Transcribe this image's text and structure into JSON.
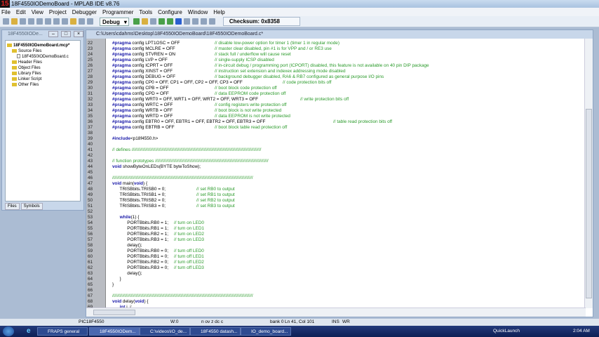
{
  "window": {
    "title": "18F4550IODemoBoard - MPLAB IDE v8.76",
    "logo": "15"
  },
  "menu": [
    "File",
    "Edit",
    "View",
    "Project",
    "Debugger",
    "Programmer",
    "Tools",
    "Configure",
    "Window",
    "Help"
  ],
  "toolbar": {
    "config": "Debug",
    "checksum": "Checksum: 0x8358"
  },
  "project": {
    "title": "18F4550IODe...",
    "tree": [
      {
        "label": "18F4550IODemoBoard.mcp*",
        "type": "project",
        "depth": 0
      },
      {
        "label": "Source Files",
        "type": "folder",
        "depth": 1
      },
      {
        "label": "18F4550IODemoBoard.c",
        "type": "file",
        "depth": 2
      },
      {
        "label": "Header Files",
        "type": "folder",
        "depth": 1
      },
      {
        "label": "Object Files",
        "type": "folder",
        "depth": 1
      },
      {
        "label": "Library Files",
        "type": "folder",
        "depth": 1
      },
      {
        "label": "Linker Script",
        "type": "folder",
        "depth": 1
      },
      {
        "label": "Other Files",
        "type": "folder",
        "depth": 1
      }
    ],
    "tabs": [
      "Files",
      "Symbols"
    ]
  },
  "editor": {
    "path": "C:\\Users\\cdahms\\Desktop\\18F4550IODemoBoard\\18F4550IODemoBoard.c*",
    "lines": [
      {
        "n": "22",
        "kw": "#pragma",
        "code": " config LPT1OSC = OFF",
        "cm": "// disable low-power option for timer 1 (timer 1 in regular mode)"
      },
      {
        "n": "23",
        "kw": "#pragma",
        "code": " config MCLRE = OFF",
        "cm": "// master clear disabled, pin #1 is for VPP and / or RE3 use"
      },
      {
        "n": "24",
        "kw": "#pragma",
        "code": " config STVREN = ON",
        "cm": "// stack full / underflow will cause reset"
      },
      {
        "n": "25",
        "kw": "#pragma",
        "code": " config LVP = OFF",
        "cm": "// single-supply ICSP disabled"
      },
      {
        "n": "26",
        "kw": "#pragma",
        "code": " config ICPRT = OFF",
        "cm": "// in-circuit debug / programming port (ICPORT) disabled, this feature is not available on 40 pin DIP package"
      },
      {
        "n": "27",
        "kw": "#pragma",
        "code": " config XINST = OFF",
        "cm": "// instruction set extension and indexex addressing mode disabled"
      },
      {
        "n": "28",
        "kw": "#pragma",
        "code": " config DEBUG = OFF",
        "cm": "// background debugger disabled, RA6 & RB7 configured as general purpose I/O pins"
      },
      {
        "n": "29",
        "kw": "#pragma",
        "code": " config CP0 = OFF, CP1 = OFF, CP2 = OFF, CP3 = OFF",
        "cm": "// code protection bits off"
      },
      {
        "n": "30",
        "kw": "#pragma",
        "code": " config CPB = OFF",
        "cm": "// boot block code protection off"
      },
      {
        "n": "31",
        "kw": "#pragma",
        "code": " config CPD = OFF",
        "cm": "// data EEPROM code protection off"
      },
      {
        "n": "32",
        "kw": "#pragma",
        "code": " config WRT0 = OFF, WRT1 = OFF, WRT2 = OFF, WRT3 = OFF",
        "cm": "// write protection bits off"
      },
      {
        "n": "33",
        "kw": "#pragma",
        "code": " config WRTC = OFF",
        "cm": "// config registers write protection off"
      },
      {
        "n": "34",
        "kw": "#pragma",
        "code": " config WRTB = OFF",
        "cm": "// boot block is not write protected"
      },
      {
        "n": "35",
        "kw": "#pragma",
        "code": " config WRTD = OFF",
        "cm": "// data EEPROM is not write protected"
      },
      {
        "n": "36",
        "kw": "#pragma",
        "code": " config EBTR0 = OFF, EBTR1 = OFF, EBTR2 = OFF, EBTR3 = OFF",
        "cm": "// table read protection bits off"
      },
      {
        "n": "37",
        "kw": "#pragma",
        "code": " config EBTRB = OFF",
        "cm": "// boot block table read protection off"
      },
      {
        "n": "38"
      },
      {
        "n": "39",
        "kw": "#include",
        "code": "<p18f4550.h>"
      },
      {
        "n": "40"
      },
      {
        "n": "41",
        "cm": "// defines ////////////////////////////////////////////////////////////////////////////////////////////////////////"
      },
      {
        "n": "42"
      },
      {
        "n": "43",
        "cm": "// function prototypes ///////////////////////////////////////////////////////////////////////////////////////////"
      },
      {
        "n": "44",
        "kw": "void",
        "code": " showByteOnLEDs(BYTE byteToShow);"
      },
      {
        "n": "45"
      },
      {
        "n": "46",
        "cm": "/////////////////////////////////////////////////////////////////////////////////////////////////////////////////"
      },
      {
        "n": "47",
        "kw": "void",
        "code": " main(",
        "kw2": "void",
        "code2": ") {"
      },
      {
        "n": "48",
        "code": "      TRISBbits.TRISB0 = 0;",
        "cm": "// set RB0 to output"
      },
      {
        "n": "49",
        "code": "      TRISBbits.TRISB1 = 0;",
        "cm": "// set RB1 to output"
      },
      {
        "n": "50",
        "code": "      TRISBbits.TRISB2 = 0;",
        "cm": "// set RB2 to output"
      },
      {
        "n": "51",
        "code": "      TRISBbits.TRISB3 = 0;",
        "cm": "// set RB3 to output"
      },
      {
        "n": "52"
      },
      {
        "n": "53",
        "pre": "      ",
        "kw": "while",
        "code": "(1) {"
      },
      {
        "n": "54",
        "code": "            PORTBbits.RB0 = 1;",
        "cm": "// turn on LED0"
      },
      {
        "n": "55",
        "code": "            PORTBbits.RB1 = 1;",
        "cm": "// turn on LED1"
      },
      {
        "n": "56",
        "code": "            PORTBbits.RB2 = 1;",
        "cm": "// turn on LED2"
      },
      {
        "n": "57",
        "code": "            PORTBbits.RB3 = 1;",
        "cm": "// turn on LED3"
      },
      {
        "n": "58",
        "code": "            delay();"
      },
      {
        "n": "59",
        "code": "            PORTBbits.RB0 = 0;",
        "cm": "// turn off LED0"
      },
      {
        "n": "60",
        "code": "            PORTBbits.RB1 = 0;",
        "cm": "// turn off LED1"
      },
      {
        "n": "61",
        "code": "            PORTBbits.RB2 = 0;",
        "cm": "// turn off LED2"
      },
      {
        "n": "62",
        "code": "            PORTBbits.RB3 = 0;",
        "cm": "// turn off LED3"
      },
      {
        "n": "63",
        "code": "            delay();"
      },
      {
        "n": "64",
        "code": "      }"
      },
      {
        "n": "65",
        "code": "}"
      },
      {
        "n": "66"
      },
      {
        "n": "67",
        "cm": "/////////////////////////////////////////////////////////////////////////////////////////////////////////////////"
      },
      {
        "n": "68",
        "kw": "void",
        "code": " delay(",
        "kw2": "void",
        "code2": ") {"
      },
      {
        "n": "69",
        "pre": "      ",
        "kw": "int",
        "code": " i, j;"
      }
    ]
  },
  "status": {
    "device": "PIC18F4550",
    "wreg": "W:0",
    "flags": "n ov z dc c",
    "bank": "bank 0",
    "position": "Ln 41, Col 101",
    "mode": "INS",
    "wr": "WR"
  },
  "taskbar": {
    "tasks": [
      "FRAPS general",
      "18F4550IODem...",
      "C:\\videos\\IO_de...",
      "18F4550 datash...",
      "IO_demo_board..."
    ],
    "quicklaunch": "QuickLaunch",
    "clock": "2:04 AM"
  }
}
